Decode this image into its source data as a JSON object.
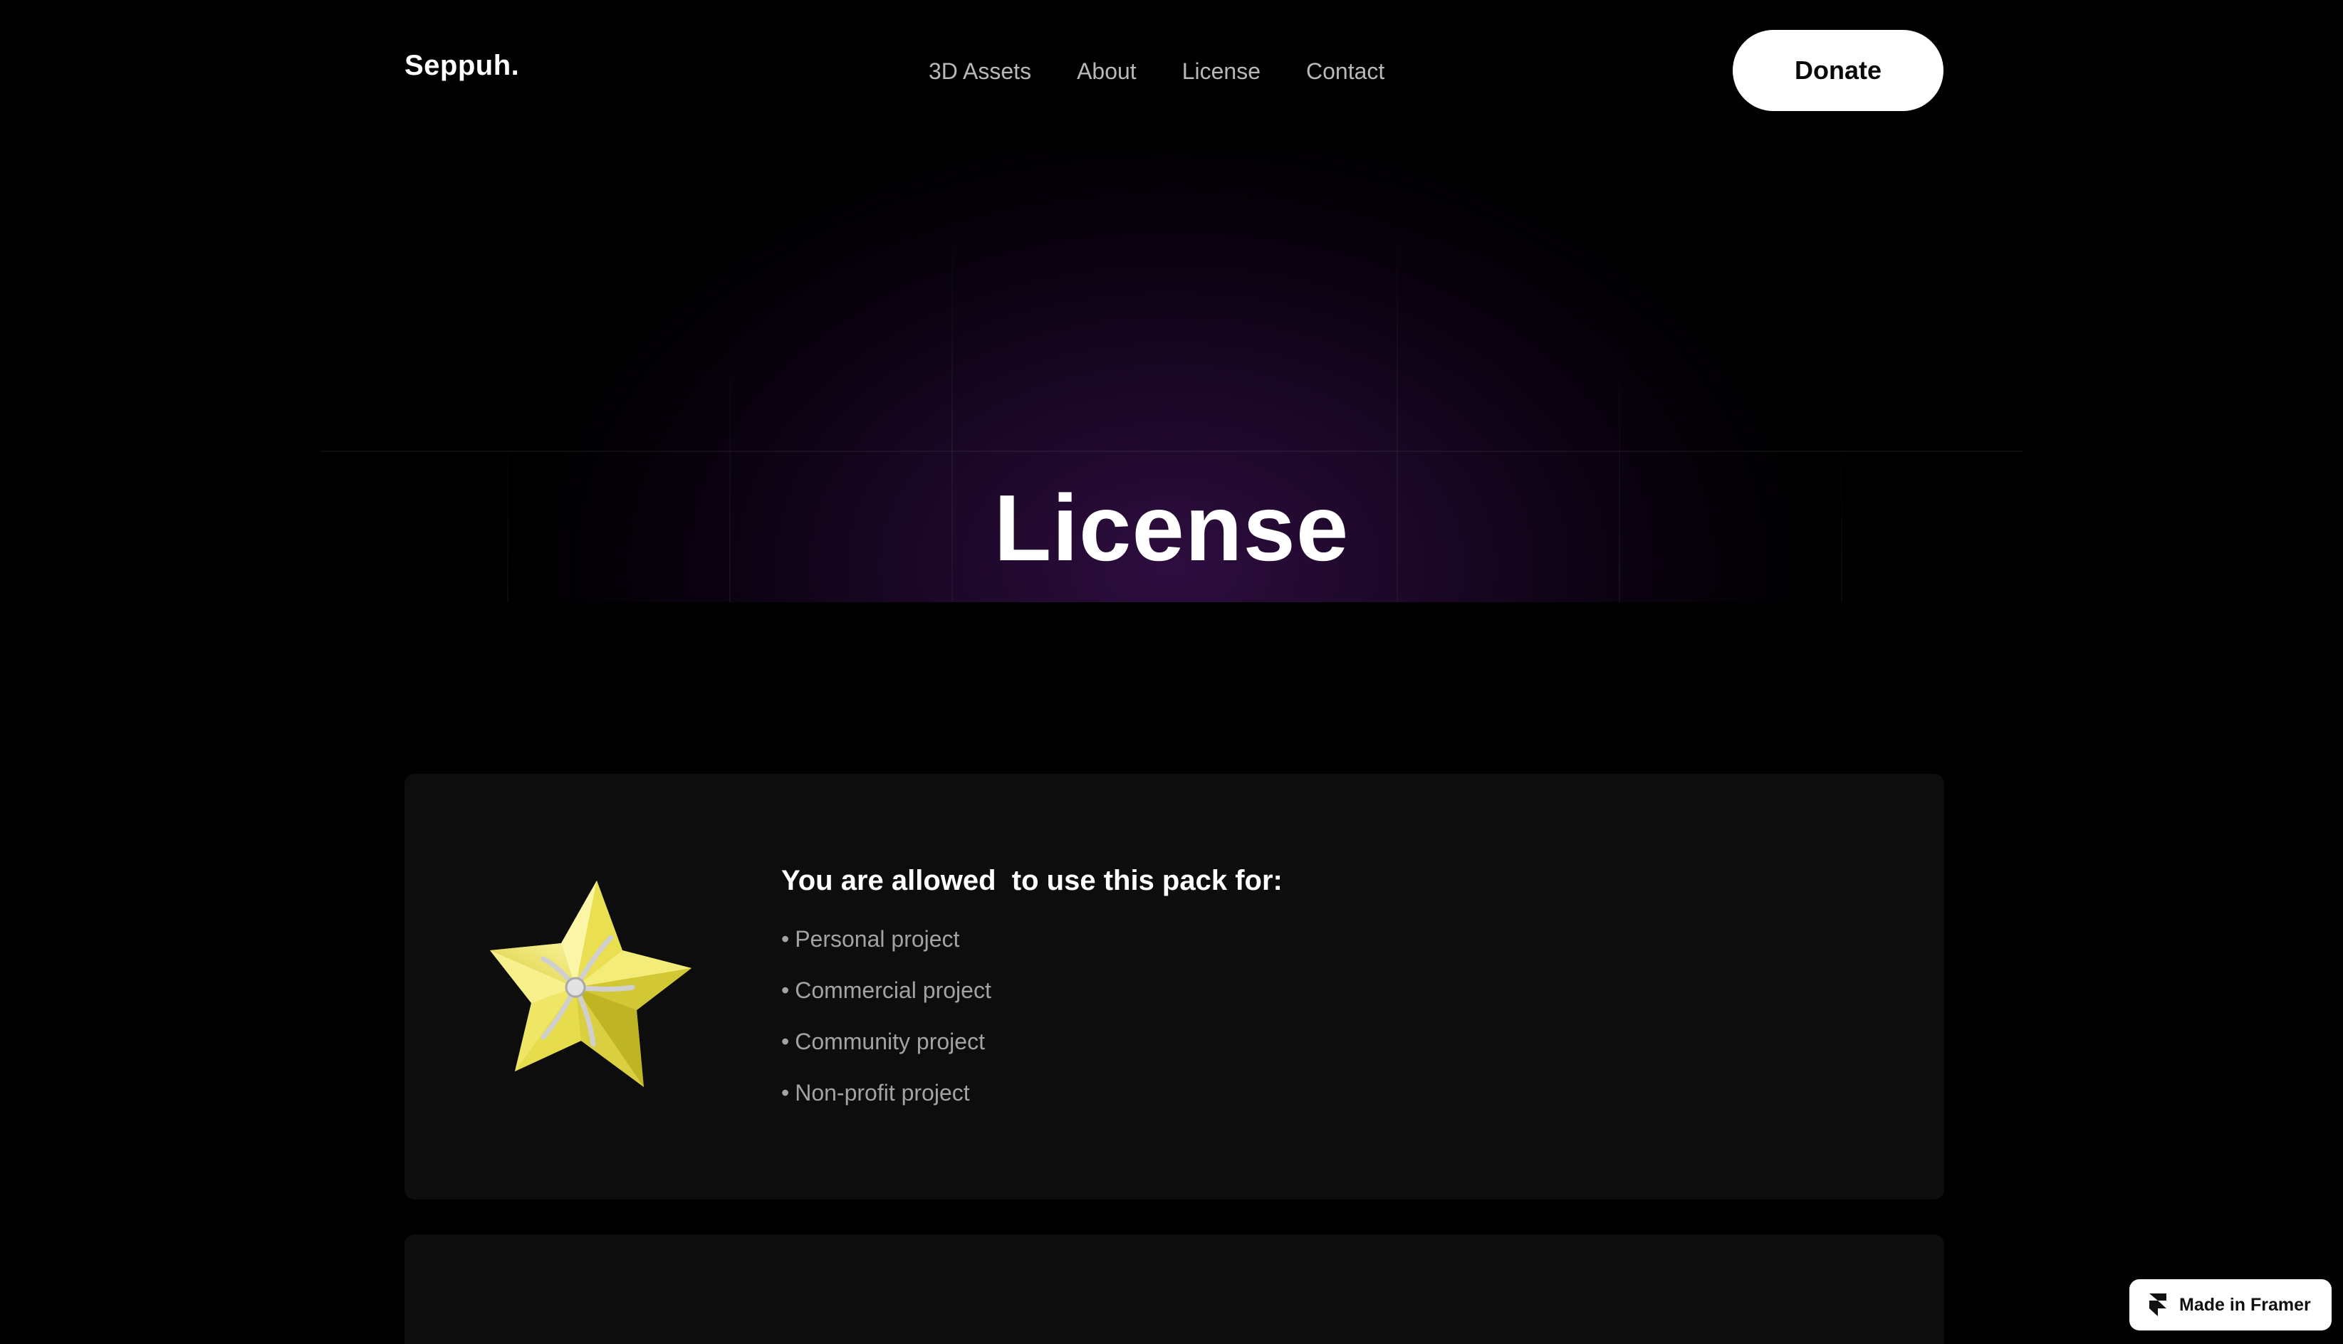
{
  "header": {
    "logo": "Seppuh.",
    "nav": [
      "3D Assets",
      "About",
      "License",
      "Contact"
    ],
    "donate_label": "Donate"
  },
  "hero": {
    "title": "License"
  },
  "card": {
    "icon": "star-icon",
    "heading": "You are allowed  to use this pack for:",
    "items": [
      "Personal project",
      "Commercial project",
      "Community project",
      "Non-profit project"
    ],
    "bullet": "•"
  },
  "badge": {
    "label": "Made in Framer",
    "icon": "framer-icon"
  },
  "colors": {
    "background": "#000000",
    "card": "#0d0d0d",
    "hero_glow": "#2e0d3f",
    "star": "#e8e04a",
    "button_bg": "#ffffff"
  }
}
